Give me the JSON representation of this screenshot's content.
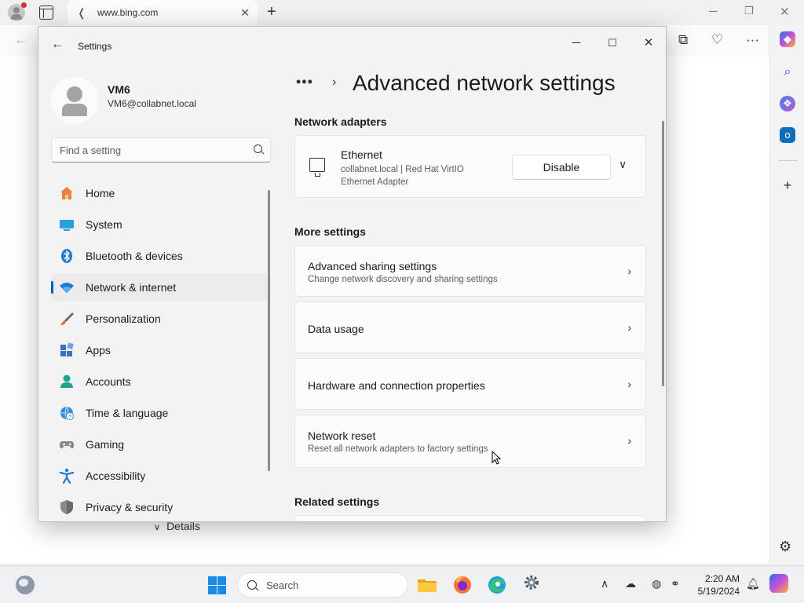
{
  "browser": {
    "tab_title": "www.bing.com",
    "tab_close": "✕",
    "new_tab": "+",
    "sidebar_items": [
      "copilot-icon",
      "search-icon",
      "apps-icon",
      "outlook-icon",
      "add-icon",
      "settings-icon"
    ]
  },
  "background_page": {
    "details_label": "Details"
  },
  "settings": {
    "window_title": "Settings",
    "profile": {
      "name": "VM6",
      "email": "VM6@collabnet.local"
    },
    "search": {
      "placeholder": "Find a setting"
    },
    "nav": [
      {
        "label": "Home",
        "icon": "home-icon",
        "color": "#e7833a"
      },
      {
        "label": "System",
        "icon": "system-icon",
        "color": "#2b9ee0"
      },
      {
        "label": "Bluetooth & devices",
        "icon": "bluetooth-icon",
        "color": "#1f7ad6"
      },
      {
        "label": "Network & internet",
        "icon": "network-icon",
        "color": "#1f7ad6",
        "active": true
      },
      {
        "label": "Personalization",
        "icon": "brush-icon",
        "color": "#d47a3c"
      },
      {
        "label": "Apps",
        "icon": "apps-icon",
        "color": "#3a6fc4"
      },
      {
        "label": "Accounts",
        "icon": "accounts-icon",
        "color": "#1fa38a"
      },
      {
        "label": "Time & language",
        "icon": "globe-clock-icon",
        "color": "#2f8fd6"
      },
      {
        "label": "Gaming",
        "icon": "gamepad-icon",
        "color": "#7a7a7a"
      },
      {
        "label": "Accessibility",
        "icon": "accessibility-icon",
        "color": "#1f7ad6"
      },
      {
        "label": "Privacy & security",
        "icon": "shield-icon",
        "color": "#7a7a7a"
      }
    ],
    "page": {
      "breadcrumb_more": "•••",
      "breadcrumb_sep": "›",
      "title": "Advanced network settings",
      "sections": {
        "network_adapters": "Network adapters",
        "more_settings": "More settings",
        "related_settings": "Related settings"
      },
      "ethernet": {
        "name": "Ethernet",
        "description": "collabnet.local | Red Hat VirtIO Ethernet Adapter",
        "disable_label": "Disable"
      },
      "more_settings_items": [
        {
          "title": "Advanced sharing settings",
          "subtitle": "Change network discovery and sharing settings"
        },
        {
          "title": "Data usage",
          "subtitle": ""
        },
        {
          "title": "Hardware and connection properties",
          "subtitle": ""
        },
        {
          "title": "Network reset",
          "subtitle": "Reset all network adapters to factory settings"
        }
      ]
    }
  },
  "taskbar": {
    "search_label": "Search",
    "time": "2:20 AM",
    "date": "5/19/2024",
    "accent_color": "#005fb8"
  }
}
